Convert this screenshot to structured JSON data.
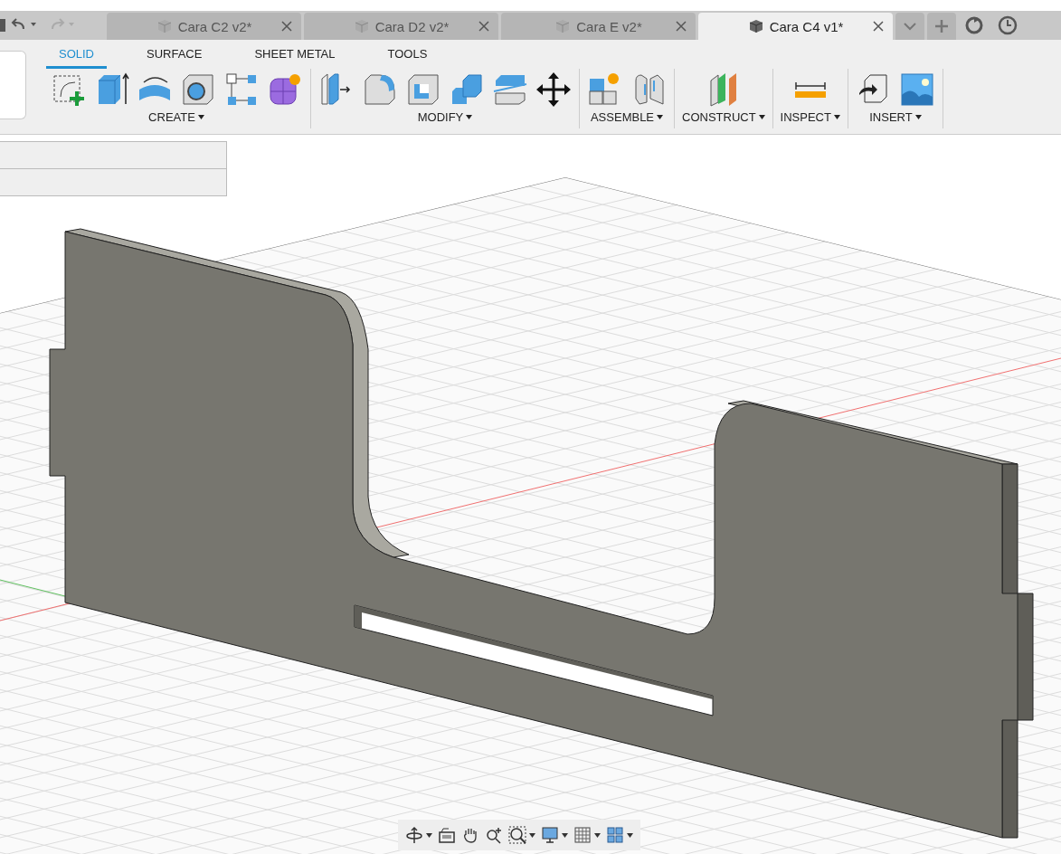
{
  "document_tabs": [
    {
      "title": "Cara C2 v2*",
      "selected": false
    },
    {
      "title": "Cara D2 v2*",
      "selected": false
    },
    {
      "title": "Cara E v2*",
      "selected": false
    },
    {
      "title": "Cara C4 v1*",
      "selected": true
    }
  ],
  "ribbon_tabs": [
    {
      "label": "SOLID",
      "selected": true
    },
    {
      "label": "SURFACE",
      "selected": false
    },
    {
      "label": "SHEET METAL",
      "selected": false
    },
    {
      "label": "TOOLS",
      "selected": false
    }
  ],
  "ribbon_groups": [
    {
      "label": "CREATE",
      "tools": [
        {
          "kind": "sketch"
        },
        {
          "kind": "extrude"
        },
        {
          "kind": "revolve"
        },
        {
          "kind": "hole"
        },
        {
          "kind": "pattern"
        },
        {
          "kind": "form"
        }
      ]
    },
    {
      "label": "MODIFY",
      "tools": [
        {
          "kind": "presspull"
        },
        {
          "kind": "fillet"
        },
        {
          "kind": "shell"
        },
        {
          "kind": "combine"
        },
        {
          "kind": "split"
        },
        {
          "kind": "move"
        }
      ]
    },
    {
      "label": "ASSEMBLE",
      "tools": [
        {
          "kind": "component"
        },
        {
          "kind": "joint"
        }
      ]
    },
    {
      "label": "CONSTRUCT",
      "tools": [
        {
          "kind": "plane"
        }
      ]
    },
    {
      "label": "INSPECT",
      "tools": [
        {
          "kind": "measure"
        }
      ]
    },
    {
      "label": "INSERT",
      "tools": [
        {
          "kind": "insert"
        },
        {
          "kind": "image"
        }
      ]
    }
  ],
  "nav_toolbar": [
    {
      "kind": "orbit"
    },
    {
      "kind": "look"
    },
    {
      "kind": "pan"
    },
    {
      "kind": "zoom"
    },
    {
      "kind": "fit"
    },
    {
      "kind": "display"
    },
    {
      "kind": "grid"
    },
    {
      "kind": "viewports"
    }
  ]
}
